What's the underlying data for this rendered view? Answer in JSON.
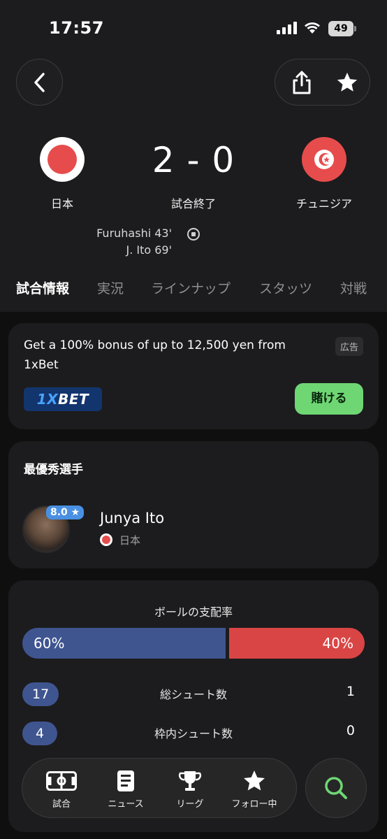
{
  "status_bar": {
    "time": "17:57",
    "battery": "49"
  },
  "match": {
    "home_team": "日本",
    "away_team": "チュニジア",
    "score": "2 - 0",
    "status": "試合終了",
    "goals": [
      {
        "text": "Furuhashi 43'"
      },
      {
        "text": "J.  Ito 69'"
      }
    ]
  },
  "tabs": [
    "試合情報",
    "実況",
    "ラインナップ",
    "スタッツ",
    "対戦"
  ],
  "active_tab": "試合情報",
  "ad": {
    "text": "Get a 100% bonus of up to 12,500 yen from 1xBet",
    "badge": "広告",
    "logo_prefix": "1X",
    "logo_suffix": "BET",
    "button": "賭ける"
  },
  "mvp": {
    "heading": "最優秀選手",
    "rating": "8.0 ★",
    "name": "Junya Ito",
    "team": "日本"
  },
  "stats": {
    "possession_title": "ボールの支配率",
    "possession_home": "60%",
    "possession_away": "40%",
    "possession_home_fraction": 0.6,
    "rows": [
      {
        "label": "総シュート数",
        "home": "17",
        "away": "1"
      },
      {
        "label": "枠内シュート数",
        "home": "4",
        "away": "0"
      }
    ]
  },
  "bottom_nav": {
    "items": [
      {
        "label": "試合",
        "icon": "pitch-icon"
      },
      {
        "label": "ニュース",
        "icon": "news-icon"
      },
      {
        "label": "リーグ",
        "icon": "trophy-icon"
      },
      {
        "label": "フォロー中",
        "icon": "star-icon"
      }
    ],
    "search_icon": "search-icon"
  },
  "colors": {
    "background": "#0f0f0f",
    "card": "#1c1c1e",
    "home": "#3f5590",
    "away": "#d94545",
    "accent_green": "#6fd674",
    "rating_blue": "#4a90e2"
  }
}
